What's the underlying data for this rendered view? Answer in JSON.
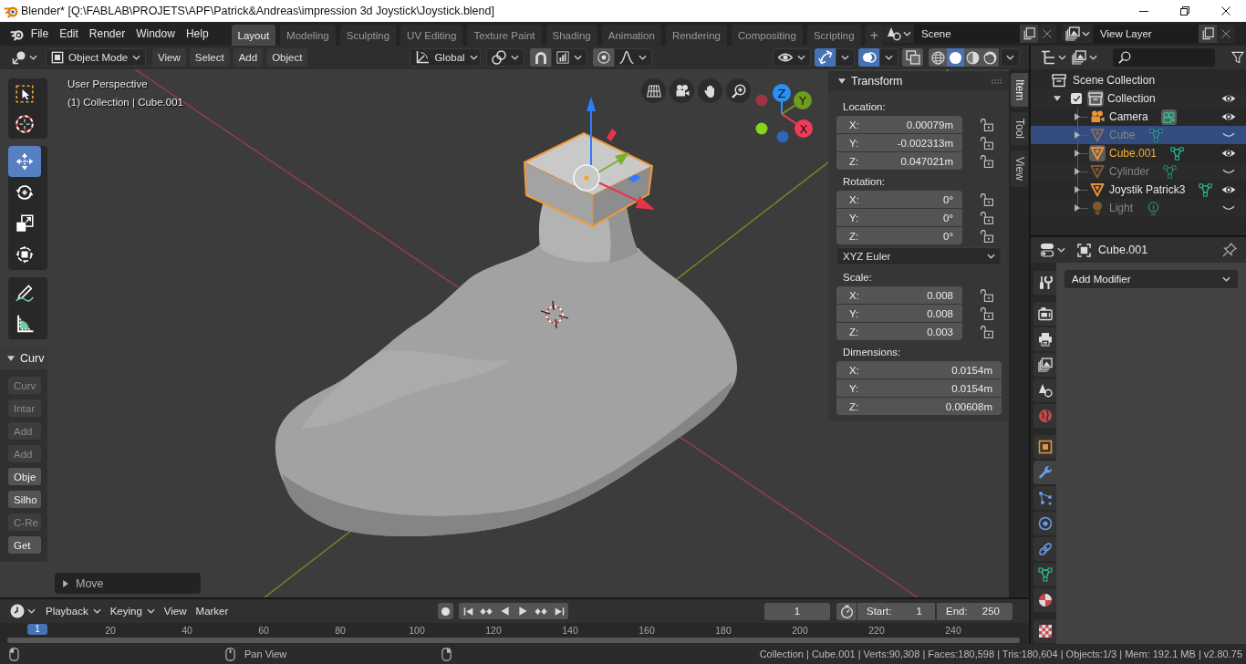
{
  "window": {
    "title": "Blender* [Q:\\FABLAB\\PROJETS\\APF\\Patrick&Andreas\\impression 3d Joystick\\Joystick.blend]"
  },
  "menu": [
    "File",
    "Edit",
    "Render",
    "Window",
    "Help"
  ],
  "workspaces": [
    {
      "label": "Layout",
      "selected": true
    },
    {
      "label": "Modeling",
      "selected": false
    },
    {
      "label": "Sculpting",
      "selected": false
    },
    {
      "label": "UV Editing",
      "selected": false
    },
    {
      "label": "Texture Paint",
      "selected": false
    },
    {
      "label": "Shading",
      "selected": false
    },
    {
      "label": "Animation",
      "selected": false
    },
    {
      "label": "Rendering",
      "selected": false
    },
    {
      "label": "Compositing",
      "selected": false
    },
    {
      "label": "Scripting",
      "selected": false
    }
  ],
  "add_workspace": "+",
  "scene": {
    "name": "Scene"
  },
  "view_layer": {
    "name": "View Layer"
  },
  "viewport_header": {
    "mode": "Object Mode",
    "menus": [
      "View",
      "Select",
      "Add",
      "Object"
    ],
    "orientation": "Global",
    "toggles": [
      {
        "kind": "gizmos",
        "on": true
      },
      {
        "kind": "overlays",
        "on": true
      },
      {
        "kind": "xray",
        "on": false
      }
    ],
    "shading": [
      {
        "kind": "wireframe",
        "selected": false
      },
      {
        "kind": "solid",
        "selected": true
      },
      {
        "kind": "material",
        "selected": false
      },
      {
        "kind": "rendered",
        "selected": false
      }
    ]
  },
  "viewport": {
    "view_name": "User Perspective",
    "context": "(1) Collection | Cube.001"
  },
  "nav_gizmo": {
    "axes": [
      {
        "label": "Z",
        "color": "#2a8ff7"
      },
      {
        "label": "Y",
        "color": "#6e9c1e"
      },
      {
        "label": "X",
        "color": "#f23a57"
      }
    ],
    "dots": [
      {
        "color": "#9e3444"
      },
      {
        "color": "#8ad31c"
      },
      {
        "color": "#2d68b4"
      }
    ]
  },
  "tools": [
    [
      {
        "kind": "select_box",
        "selected": false
      },
      {
        "kind": "cursor",
        "selected": false
      }
    ],
    [
      {
        "kind": "move",
        "selected": true
      },
      {
        "kind": "rotate",
        "selected": false
      },
      {
        "kind": "scale",
        "selected": false
      },
      {
        "kind": "transform",
        "selected": false
      }
    ],
    [
      {
        "kind": "annotate",
        "selected": false
      },
      {
        "kind": "measure",
        "selected": false
      }
    ]
  ],
  "addon_panel": {
    "title": "Curv",
    "expanded": true,
    "buttons": [
      {
        "label": "Curv",
        "disabled": true
      },
      {
        "label": "Intar",
        "disabled": true
      },
      {
        "label": "Add",
        "disabled": true
      },
      {
        "label": "Add",
        "disabled": true
      },
      {
        "label": "Obje",
        "disabled": false
      },
      {
        "label": "Silho",
        "disabled": false
      },
      {
        "label": "C-Re",
        "disabled": true
      },
      {
        "label": "Get",
        "disabled": false
      }
    ]
  },
  "operator_panel": {
    "title": "Move",
    "expanded": false
  },
  "transform": {
    "title": "Transform",
    "expanded": true,
    "groups": [
      {
        "label": "Location:",
        "fields": [
          {
            "axis": "X:",
            "value": "0.00079m",
            "locked": false
          },
          {
            "axis": "Y:",
            "value": "-0.002313m",
            "locked": false
          },
          {
            "axis": "Z:",
            "value": "0.047021m",
            "locked": false
          }
        ]
      },
      {
        "label": "Rotation:",
        "fields": [
          {
            "axis": "X:",
            "value": "0°",
            "locked": false
          },
          {
            "axis": "Y:",
            "value": "0°",
            "locked": false
          },
          {
            "axis": "Z:",
            "value": "0°",
            "locked": false
          }
        ],
        "mode": "XYZ Euler"
      },
      {
        "label": "Scale:",
        "fields": [
          {
            "axis": "X:",
            "value": "0.008",
            "locked": false
          },
          {
            "axis": "Y:",
            "value": "0.008",
            "locked": false
          },
          {
            "axis": "Z:",
            "value": "0.003",
            "locked": false
          }
        ]
      },
      {
        "label": "Dimensions:",
        "fields": [
          {
            "axis": "X:",
            "value": "0.0154m"
          },
          {
            "axis": "Y:",
            "value": "0.0154m"
          },
          {
            "axis": "Z:",
            "value": "0.00608m"
          }
        ]
      }
    ]
  },
  "sidebar_tabs": [
    {
      "label": "Item",
      "selected": true
    },
    {
      "label": "Tool",
      "selected": false
    },
    {
      "label": "View",
      "selected": false
    }
  ],
  "outliner": {
    "tree": [
      {
        "name": "Scene Collection",
        "kind": "scene_collection",
        "children": [
          {
            "name": "Collection",
            "kind": "collection",
            "expanded": true,
            "checked": true,
            "active": true,
            "visible": true,
            "children": [
              {
                "name": "Camera",
                "kind": "camera",
                "expanded": false,
                "selected": false,
                "active": false,
                "visible": true
              },
              {
                "name": "Cube",
                "kind": "mesh",
                "expanded": false,
                "selected": true,
                "active": false,
                "visible": false
              },
              {
                "name": "Cube.001",
                "kind": "mesh",
                "expanded": false,
                "selected": false,
                "active": true,
                "visible": true
              },
              {
                "name": "Cylinder",
                "kind": "mesh",
                "expanded": false,
                "selected": false,
                "active": false,
                "visible": false
              },
              {
                "name": "Joystik Patrick3",
                "kind": "mesh",
                "expanded": false,
                "selected": false,
                "active": false,
                "visible": true
              },
              {
                "name": "Light",
                "kind": "light",
                "expanded": false,
                "selected": false,
                "active": false,
                "visible": false
              }
            ]
          }
        ]
      }
    ]
  },
  "properties": {
    "object": "Cube.001",
    "tabs": [
      [
        {
          "kind": "tool",
          "selected": false
        }
      ],
      [
        {
          "kind": "render",
          "selected": false
        },
        {
          "kind": "output",
          "selected": false
        },
        {
          "kind": "view_layer",
          "selected": false
        },
        {
          "kind": "scene",
          "selected": false
        },
        {
          "kind": "world",
          "selected": false
        }
      ],
      [
        {
          "kind": "object",
          "selected": false
        },
        {
          "kind": "modifiers",
          "selected": true
        },
        {
          "kind": "particles",
          "selected": false
        },
        {
          "kind": "physics",
          "selected": false
        },
        {
          "kind": "constraints",
          "selected": false
        },
        {
          "kind": "data",
          "selected": false
        },
        {
          "kind": "material",
          "selected": false
        }
      ],
      [
        {
          "kind": "texture",
          "selected": false
        }
      ]
    ],
    "add_modifier": "Add Modifier"
  },
  "timeline": {
    "menus": [
      {
        "label": "Playback",
        "kind": "dropdown"
      },
      {
        "label": "Keying",
        "kind": "dropdown"
      },
      {
        "label": "View",
        "kind": "menu"
      },
      {
        "label": "Marker",
        "kind": "menu"
      }
    ],
    "current_frame": "1",
    "start": {
      "label": "Start:",
      "value": "1"
    },
    "end": {
      "label": "End:",
      "value": "250"
    },
    "playhead": "1",
    "ruler": [
      "20",
      "40",
      "60",
      "80",
      "100",
      "120",
      "140",
      "160",
      "180",
      "200",
      "220",
      "240"
    ]
  },
  "status_bar": {
    "hints": [
      {
        "kind": "left_mouse"
      },
      {
        "kind": "middle_mouse",
        "label": "Pan View"
      },
      {
        "kind": "right_mouse"
      }
    ],
    "stats": "Collection | Cube.001 | Verts:90,308 | Faces:180,598 | Tris:180,604 | Objects:1/3 | Mem: 192.1 MB | v2.80.75"
  }
}
